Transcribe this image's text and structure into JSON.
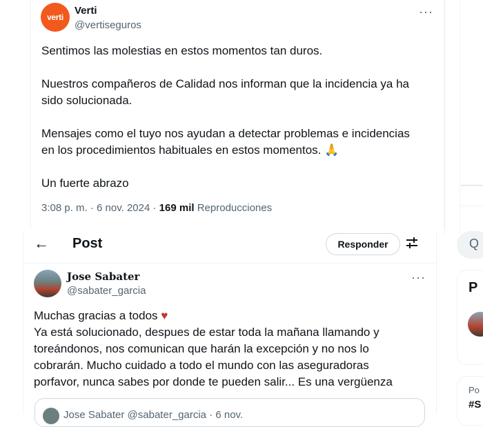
{
  "top_tweet": {
    "author_name": "Verti",
    "author_handle": "@vertiseguros",
    "avatar_text": "verti",
    "paragraphs": [
      "Sentimos las molestias en estos momentos tan duros.",
      "Nuestros compañeros de Calidad nos informan que la incidencia ya ha\nsido solucionada.",
      "Mensajes como el tuyo nos ayudan a detectar problemas e incidencias\nen los procedimientos habituales en estos momentos. 🙏",
      "Un fuerte abrazo"
    ],
    "timestamp": "3:08 p. m. · 6 nov. 2024",
    "views_count": "169 mil",
    "views_label": "Reproducciones",
    "more_glyph": "···"
  },
  "post_view": {
    "back_glyph": "←",
    "title": "Post",
    "reply_label": "Responder",
    "filter_glyph": "⇄",
    "tweet": {
      "author_name": "Jose Sabater",
      "author_handle": "@sabater_garcia",
      "more_glyph": "···",
      "lines": [
        "Muchas gracias a todos ♥",
        "Ya está solucionado, despues de estar toda la mañana llamando y",
        "toreándonos, nos comunican que harán la excepción y no nos lo",
        "cobrarán. Mucho cuidado a todo el mundo con las aseguradoras",
        "porfavor, nunca sabes por donde te pueden salir... Es una vergüenza"
      ],
      "quote_preview": "Jose Sabater  @sabater_garcia · 6 nov."
    }
  },
  "sidebar": {
    "search_glyph": "Q",
    "card1_initial": "P",
    "card2_line1": "Po",
    "card2_line2": "#S"
  },
  "colors": {
    "verti_orange": "#f2591c",
    "heart_red": "#c0392b",
    "text_primary": "#0f1419",
    "text_secondary": "#536471"
  }
}
